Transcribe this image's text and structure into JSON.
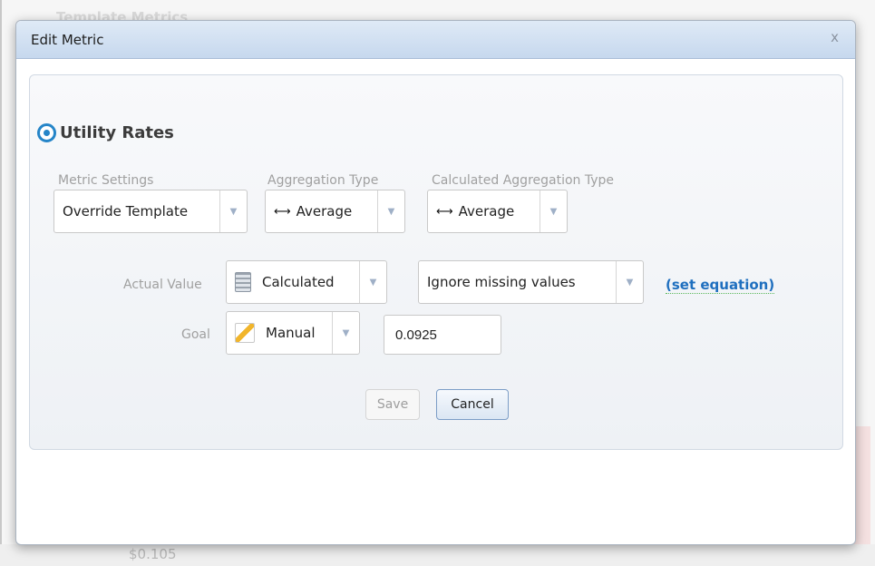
{
  "background": {
    "title": "Template Metrics",
    "value_text": "$0.105"
  },
  "dialog": {
    "title": "Edit Metric",
    "close_label": "x"
  },
  "metric": {
    "name": "Utility Rates",
    "radio_icon": "radio-selected-icon",
    "accent_color": "#2585c8"
  },
  "settings": {
    "metric_settings_label": "Metric Settings",
    "metric_settings_value": "Override Template",
    "aggregation_type_label": "Aggregation Type",
    "aggregation_type_value": "Average",
    "calculated_aggregation_type_label": "Calculated Aggregation Type",
    "calculated_aggregation_type_value": "Average",
    "aggregation_icon": "double-arrow-icon"
  },
  "actual_value": {
    "label": "Actual Value",
    "mode_value": "Calculated",
    "mode_icon": "calculator-icon",
    "missing_values_option": "Ignore missing values",
    "equation_link": "(set equation)"
  },
  "goal": {
    "label": "Goal",
    "mode_value": "Manual",
    "mode_icon": "pencil-icon",
    "value": "0.0925"
  },
  "buttons": {
    "save_label": "Save",
    "cancel_label": "Cancel"
  }
}
